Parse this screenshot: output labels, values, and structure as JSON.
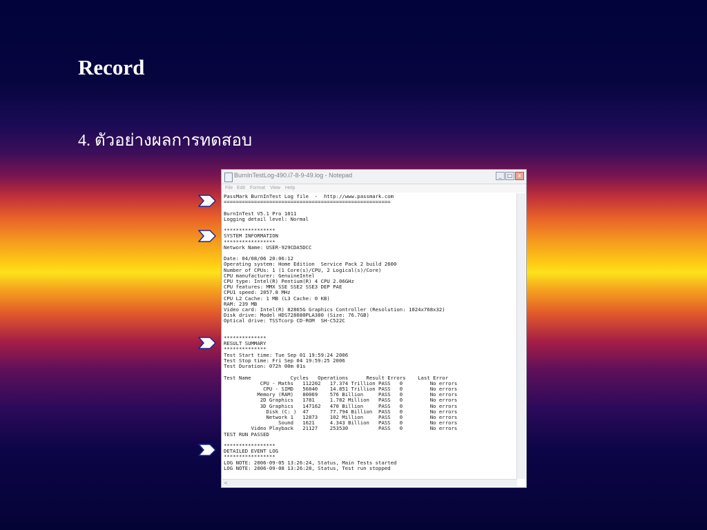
{
  "slide": {
    "title": "Record",
    "subtitle": "4. ตัวอย่างผลการทดสอบ"
  },
  "notepad": {
    "window_title": "BurnInTestLog-490.i7-8-9-49.log - Notepad",
    "menu": [
      "File",
      "Edit",
      "Format",
      "View",
      "Help"
    ],
    "buttons": {
      "minimize": "_",
      "maximize": "□",
      "close": "x"
    },
    "log_lines": [
      "PassMark BurnInTest Log file  -  http://www.passmark.com",
      "=======================================================",
      "",
      "BurnInTest V5.1 Pro 1011",
      "Logging detail level: Normal",
      "",
      "*****************",
      "SYSTEM INFORMATION",
      "*****************",
      "Network Name: USER-929CDA5DCC",
      "",
      "Date: 04/08/06 20:06:12",
      "Operating system: Home Edition  Service Pack 2 build 2600",
      "Number of CPUs: 1 (1 Core(s)/CPU, 2 Logical(s)/Core)",
      "CPU manufacturer: GenuineIntel",
      "CPU type: Intel(R) Pentium(R) 4 CPU 2.06GHz",
      "CPU features: MMX SSE SSE2 SSE3 DEP PAE",
      "CPU1 speed: 2057.8 MHz",
      "CPU L2 Cache: 1 MB (L3 Cache: 0 KB)",
      "RAM: 239 MB",
      "Video card: Intel(R) 82865G Graphics Controller (Resolution: 1024x768x32)",
      "Disk drive: Model HDS728080PLA380 (Size: 76.7GB)",
      "Optical drive: TSSTcorp CD-ROM  SH-C522C",
      "",
      "",
      "**************",
      "RESULT SUMMARY",
      "**************",
      "Test Start time: Tue Sep 01 19:59:24 2006",
      "Test Stop time: Fri Sep 04 19:59:25 2006",
      "Test Duration: 072h 00m 01s",
      "",
      "Test Name             Cycles   Operations      Result Errors    Last Error",
      "            CPU - Maths   112202   17.374 Trillion PASS   0         No errors",
      "             CPU - SIMD   56840    14.851 Trillion PASS   0         No errors",
      "           Memory (RAM)   80069    576 Billion     PASS   0         No errors",
      "            2D Graphics   1781     1.782 Million   PASS   0         No errors",
      "            3D Graphics   147162   470 Billion     PASS   0         No errors",
      "              Disk (C: )  47       77.794 Billion  PASS   0         No errors",
      "              Network 1   12873    102 Million     PASS   0         No errors",
      "                  Sound   1621     4.343 Billion   PASS   0         No errors",
      "         Video Playback   21127    253530          PASS   0         No errors",
      "TEST RUN PASSED",
      "",
      "*****************",
      "DETAILED EVENT LOG",
      "*****************",
      "LOG NOTE: 2006-09-05 13:26:24, Status, Main Tests started",
      "LOG NOTE: 2006-09-08 13:26:28, Status, Test run stopped"
    ]
  },
  "colors": {
    "arrow_fill": "#ffffff",
    "arrow_stroke": "#1a2a8a",
    "text": "#ffffff"
  }
}
